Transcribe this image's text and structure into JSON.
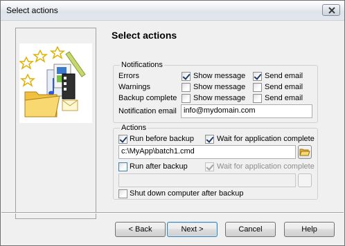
{
  "window": {
    "title": "Select actions"
  },
  "page": {
    "heading": "Select actions"
  },
  "notifications": {
    "title": "Notifications",
    "rows": [
      {
        "label": "Errors",
        "show_message": {
          "label": "Show message",
          "checked": true
        },
        "send_email": {
          "label": "Send email",
          "checked": true
        }
      },
      {
        "label": "Warnings",
        "show_message": {
          "label": "Show message",
          "checked": false
        },
        "send_email": {
          "label": "Send email",
          "checked": false
        }
      },
      {
        "label": "Backup complete",
        "show_message": {
          "label": "Show message",
          "checked": false
        },
        "send_email": {
          "label": "Send email",
          "checked": false
        }
      }
    ],
    "email_label": "Notification email",
    "email_value": "info@mydomain.com"
  },
  "actions": {
    "title": "Actions",
    "run_before": {
      "label": "Run before backup",
      "checked": true
    },
    "wait_before": {
      "label": "Wait for application complete",
      "checked": true
    },
    "before_path": "c:\\MyApp\\batch1.cmd",
    "run_after": {
      "label": "Run after backup",
      "checked": false
    },
    "wait_after": {
      "label": "Wait for application complete",
      "checked": true,
      "disabled": true
    },
    "after_path": "",
    "shutdown": {
      "label": "Shut down computer after backup",
      "checked": false
    }
  },
  "buttons": {
    "back": "< Back",
    "next": "Next >",
    "cancel": "Cancel",
    "help": "Help"
  },
  "icons": [
    "close-icon",
    "folder-open-icon",
    "backup-illustration"
  ]
}
